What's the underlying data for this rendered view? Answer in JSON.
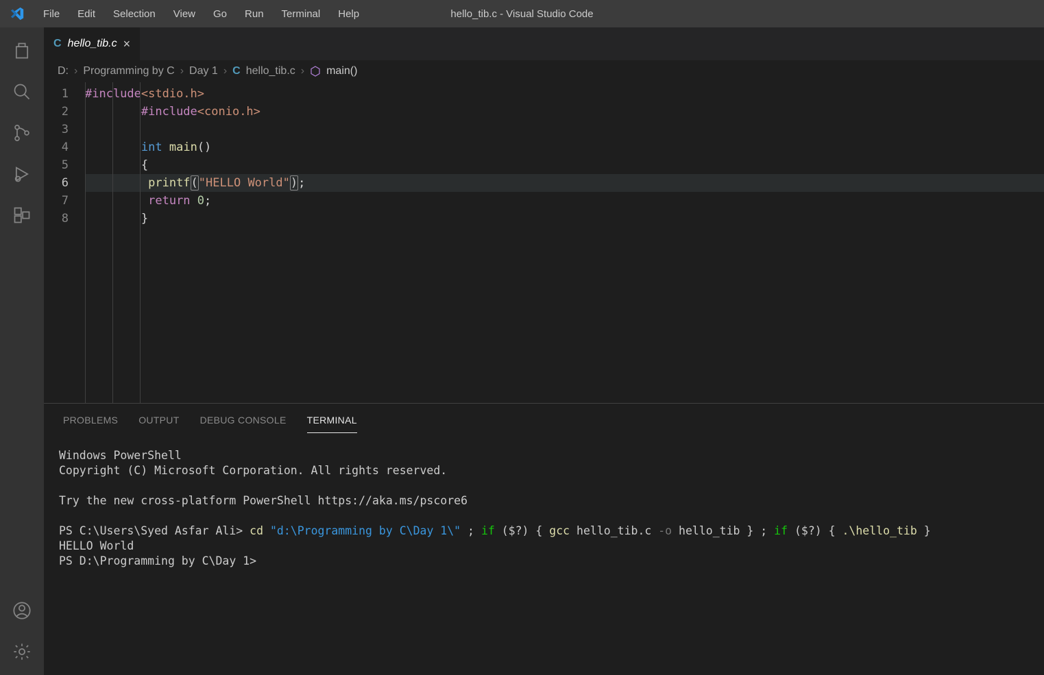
{
  "window": {
    "title": "hello_tib.c - Visual Studio Code"
  },
  "menu": [
    "File",
    "Edit",
    "Selection",
    "View",
    "Go",
    "Run",
    "Terminal",
    "Help"
  ],
  "tab": {
    "icon_letter": "C",
    "filename": "hello_tib.c"
  },
  "breadcrumb": {
    "drive": "D:",
    "p1": "Programming by C",
    "p2": "Day 1",
    "file": "hello_tib.c",
    "sym": "main()"
  },
  "gutter": [
    "1",
    "2",
    "3",
    "4",
    "5",
    "6",
    "7",
    "8"
  ],
  "code": {
    "l1": {
      "kw": "#include",
      "hdr": "<stdio.h>"
    },
    "l2": {
      "ind": "        ",
      "kw": "#include",
      "hdr": "<conio.h>"
    },
    "l3": "",
    "l4": {
      "ind": "        ",
      "type": "int",
      "sp": " ",
      "fn": "main",
      "par": "()"
    },
    "l5": {
      "ind": "        ",
      "br": "{"
    },
    "l6": {
      "ind": "         ",
      "fn": "printf",
      "lp": "(",
      "str": "\"HELLO World\"",
      "rp": ")",
      "semi": ";"
    },
    "l7": {
      "ind": "         ",
      "kw": "return",
      "sp": " ",
      "num": "0",
      "semi": ";"
    },
    "l8": {
      "ind": "        ",
      "br": "}"
    }
  },
  "panel_tabs": {
    "problems": "PROBLEMS",
    "output": "OUTPUT",
    "debug": "DEBUG CONSOLE",
    "terminal": "TERMINAL"
  },
  "terminal": {
    "l1": "Windows PowerShell",
    "l2": "Copyright (C) Microsoft Corporation. All rights reserved.",
    "l3": "",
    "l4": "Try the new cross-platform PowerShell https://aka.ms/pscore6",
    "l5": "",
    "prompt1": "PS C:\\Users\\Syed Asfar Ali> ",
    "cmd_cd": "cd",
    "cmd_path": " \"d:\\Programming by C\\Day 1\\\"",
    "seg_sep1": " ; ",
    "seg_if1": "if",
    "seg_cond1": " ($?) { ",
    "cmd_gcc": "gcc",
    "seg_gcc_arg": " hello_tib.c ",
    "seg_o": "-o",
    "seg_out": " hello_tib } ; ",
    "seg_if2": "if",
    "seg_cond2": " ($?) { ",
    "cmd_run": ".\\hello_tib",
    "seg_end": " }",
    "out": "HELLO World",
    "prompt2": "PS D:\\Programming by C\\Day 1>"
  }
}
